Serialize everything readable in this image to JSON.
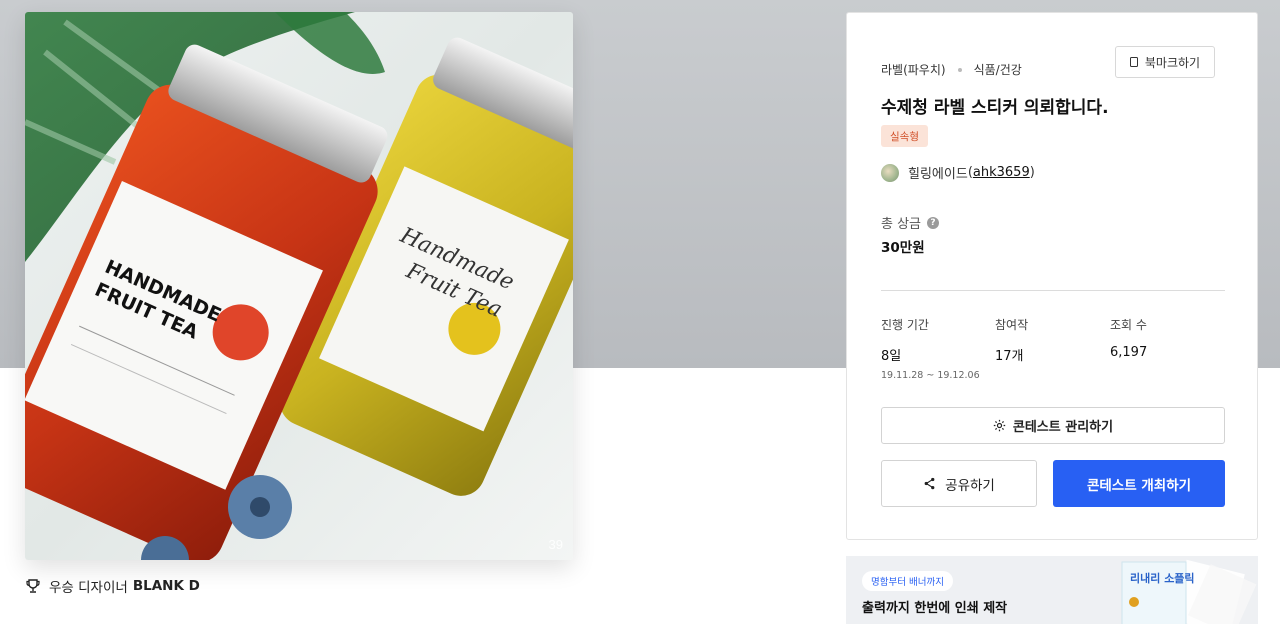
{
  "hero": {
    "image_count": "39"
  },
  "winner": {
    "prefix": "우승 디자이너",
    "name": "BLANK D"
  },
  "contest": {
    "category": "라벨(파우치)",
    "subcategory": "식품/건강",
    "bookmark_label": "북마크하기",
    "title": "수제청 라벨 스티커 의뢰합니다.",
    "badge": "실속형",
    "host_name": "힐링에이드",
    "host_id": "ahk3659",
    "prize_label": "총 상금",
    "prize_value": "30만원",
    "stats": {
      "period_label": "진행 기간",
      "period_value": "8일",
      "period_start": "19.11.28",
      "period_end": "19.12.06",
      "entries_label": "참여작",
      "entries_value": "17개",
      "views_label": "조회 수",
      "views_value": "6,197"
    },
    "manage_label": "콘테스트 관리하기",
    "share_label": "공유하기",
    "host_label": "콘테스트 개최하기"
  },
  "ad": {
    "pill": "명함부터 배너까지",
    "text": "출력까지 한번에 인쇄 제작",
    "art_text": "리내리 소플릭"
  },
  "colors": {
    "primary": "#2860f3",
    "badge_bg": "#fbe3d8",
    "badge_text": "#d1512a"
  }
}
